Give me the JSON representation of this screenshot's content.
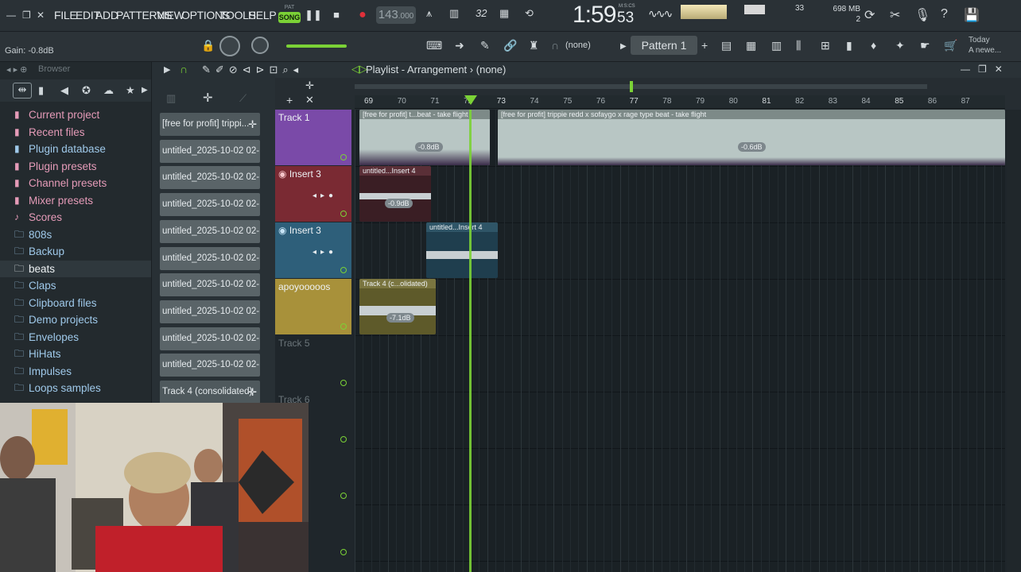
{
  "menu": {
    "items": [
      "FILE",
      "EDIT",
      "ADD",
      "PATTERNS",
      "VIEW",
      "OPTIONS",
      "TOOLS",
      "HELP"
    ]
  },
  "transport": {
    "mode_top": "PAT",
    "mode": "SONG",
    "tempo": "143",
    "tempo_decimal": ".000",
    "time_main": "1:59",
    "time_sub": "53",
    "time_label": "M:S:CS",
    "step_label": "32",
    "cpu": "33",
    "memory": "698 MB",
    "polyphony": "2"
  },
  "toolbar": {
    "hint": "Gain: -0.8dB",
    "snap": "(none)",
    "pattern": "Pattern 1",
    "news_date": "Today",
    "news_text": "A newe..."
  },
  "browser": {
    "title": "Browser",
    "items": [
      {
        "label": "Current project",
        "icon": "file-icon",
        "style": "pink"
      },
      {
        "label": "Recent files",
        "icon": "file-icon",
        "style": "pink"
      },
      {
        "label": "Plugin database",
        "icon": "file-icon",
        "style": "blue"
      },
      {
        "label": "Plugin presets",
        "icon": "file-icon",
        "style": "pink"
      },
      {
        "label": "Channel presets",
        "icon": "file-icon",
        "style": "pink"
      },
      {
        "label": "Mixer presets",
        "icon": "file-icon",
        "style": "pink"
      },
      {
        "label": "Scores",
        "icon": "note-icon",
        "style": "pink"
      },
      {
        "label": "808s",
        "icon": "folder-icon",
        "style": "blue"
      },
      {
        "label": "Backup",
        "icon": "folder-icon",
        "style": "blue"
      },
      {
        "label": "beats",
        "icon": "folder-icon",
        "style": "sel"
      },
      {
        "label": "Claps",
        "icon": "folder-icon",
        "style": "blue"
      },
      {
        "label": "Clipboard files",
        "icon": "folder-icon",
        "style": "blue"
      },
      {
        "label": "Demo projects",
        "icon": "folder-icon",
        "style": "blue"
      },
      {
        "label": "Envelopes",
        "icon": "folder-icon",
        "style": "blue"
      },
      {
        "label": "HiHats",
        "icon": "folder-icon",
        "style": "blue"
      },
      {
        "label": "Impulses",
        "icon": "folder-icon",
        "style": "blue"
      },
      {
        "label": "Loops samples",
        "icon": "folder-icon",
        "style": "blue"
      }
    ]
  },
  "picker": {
    "clips": [
      "[free for profit] trippi...",
      "untitled_2025-10-02 02-...",
      "untitled_2025-10-02 02-...",
      "untitled_2025-10-02 02-...",
      "untitled_2025-10-02 02-...",
      "untitled_2025-10-02 02-...",
      "untitled_2025-10-02 02-...",
      "untitled_2025-10-02 02-...",
      "untitled_2025-10-02 02-...",
      "untitled_2025-10-02 02-...",
      "Track 4 (consolidated)"
    ]
  },
  "playlist": {
    "title": "Playlist - Arrangement",
    "sep": "›",
    "pattern": "(none)",
    "ruler": [
      "69",
      "70",
      "71",
      "72",
      "73",
      "74",
      "75",
      "76",
      "77",
      "78",
      "79",
      "80",
      "81",
      "82",
      "83",
      "84",
      "85",
      "86",
      "87"
    ],
    "tracks": [
      {
        "name": "Track 1",
        "color": "#7a4aa8"
      },
      {
        "name": "Insert 3",
        "color": "#7a2a33"
      },
      {
        "name": "Insert 3",
        "color": "#2e5f7a"
      },
      {
        "name": "apoyooooos",
        "color": "#a8913a"
      },
      {
        "name": "Track 5",
        "color": ""
      },
      {
        "name": "Track 6",
        "color": ""
      }
    ],
    "clips": [
      {
        "title": "[free for profit] t...beat - take flight",
        "gain": "-0.8dB"
      },
      {
        "title": "[free for profit] trippie redd x sofaygo x rage type beat - take flight",
        "gain": "-0.6dB"
      },
      {
        "title": "untitled...Insert 4",
        "gain": "-0.9dB"
      },
      {
        "title": "untitled...Insert 4",
        "gain": ""
      },
      {
        "title": "Track 4 (c...olidated)",
        "gain": "-7.1dB"
      }
    ]
  }
}
